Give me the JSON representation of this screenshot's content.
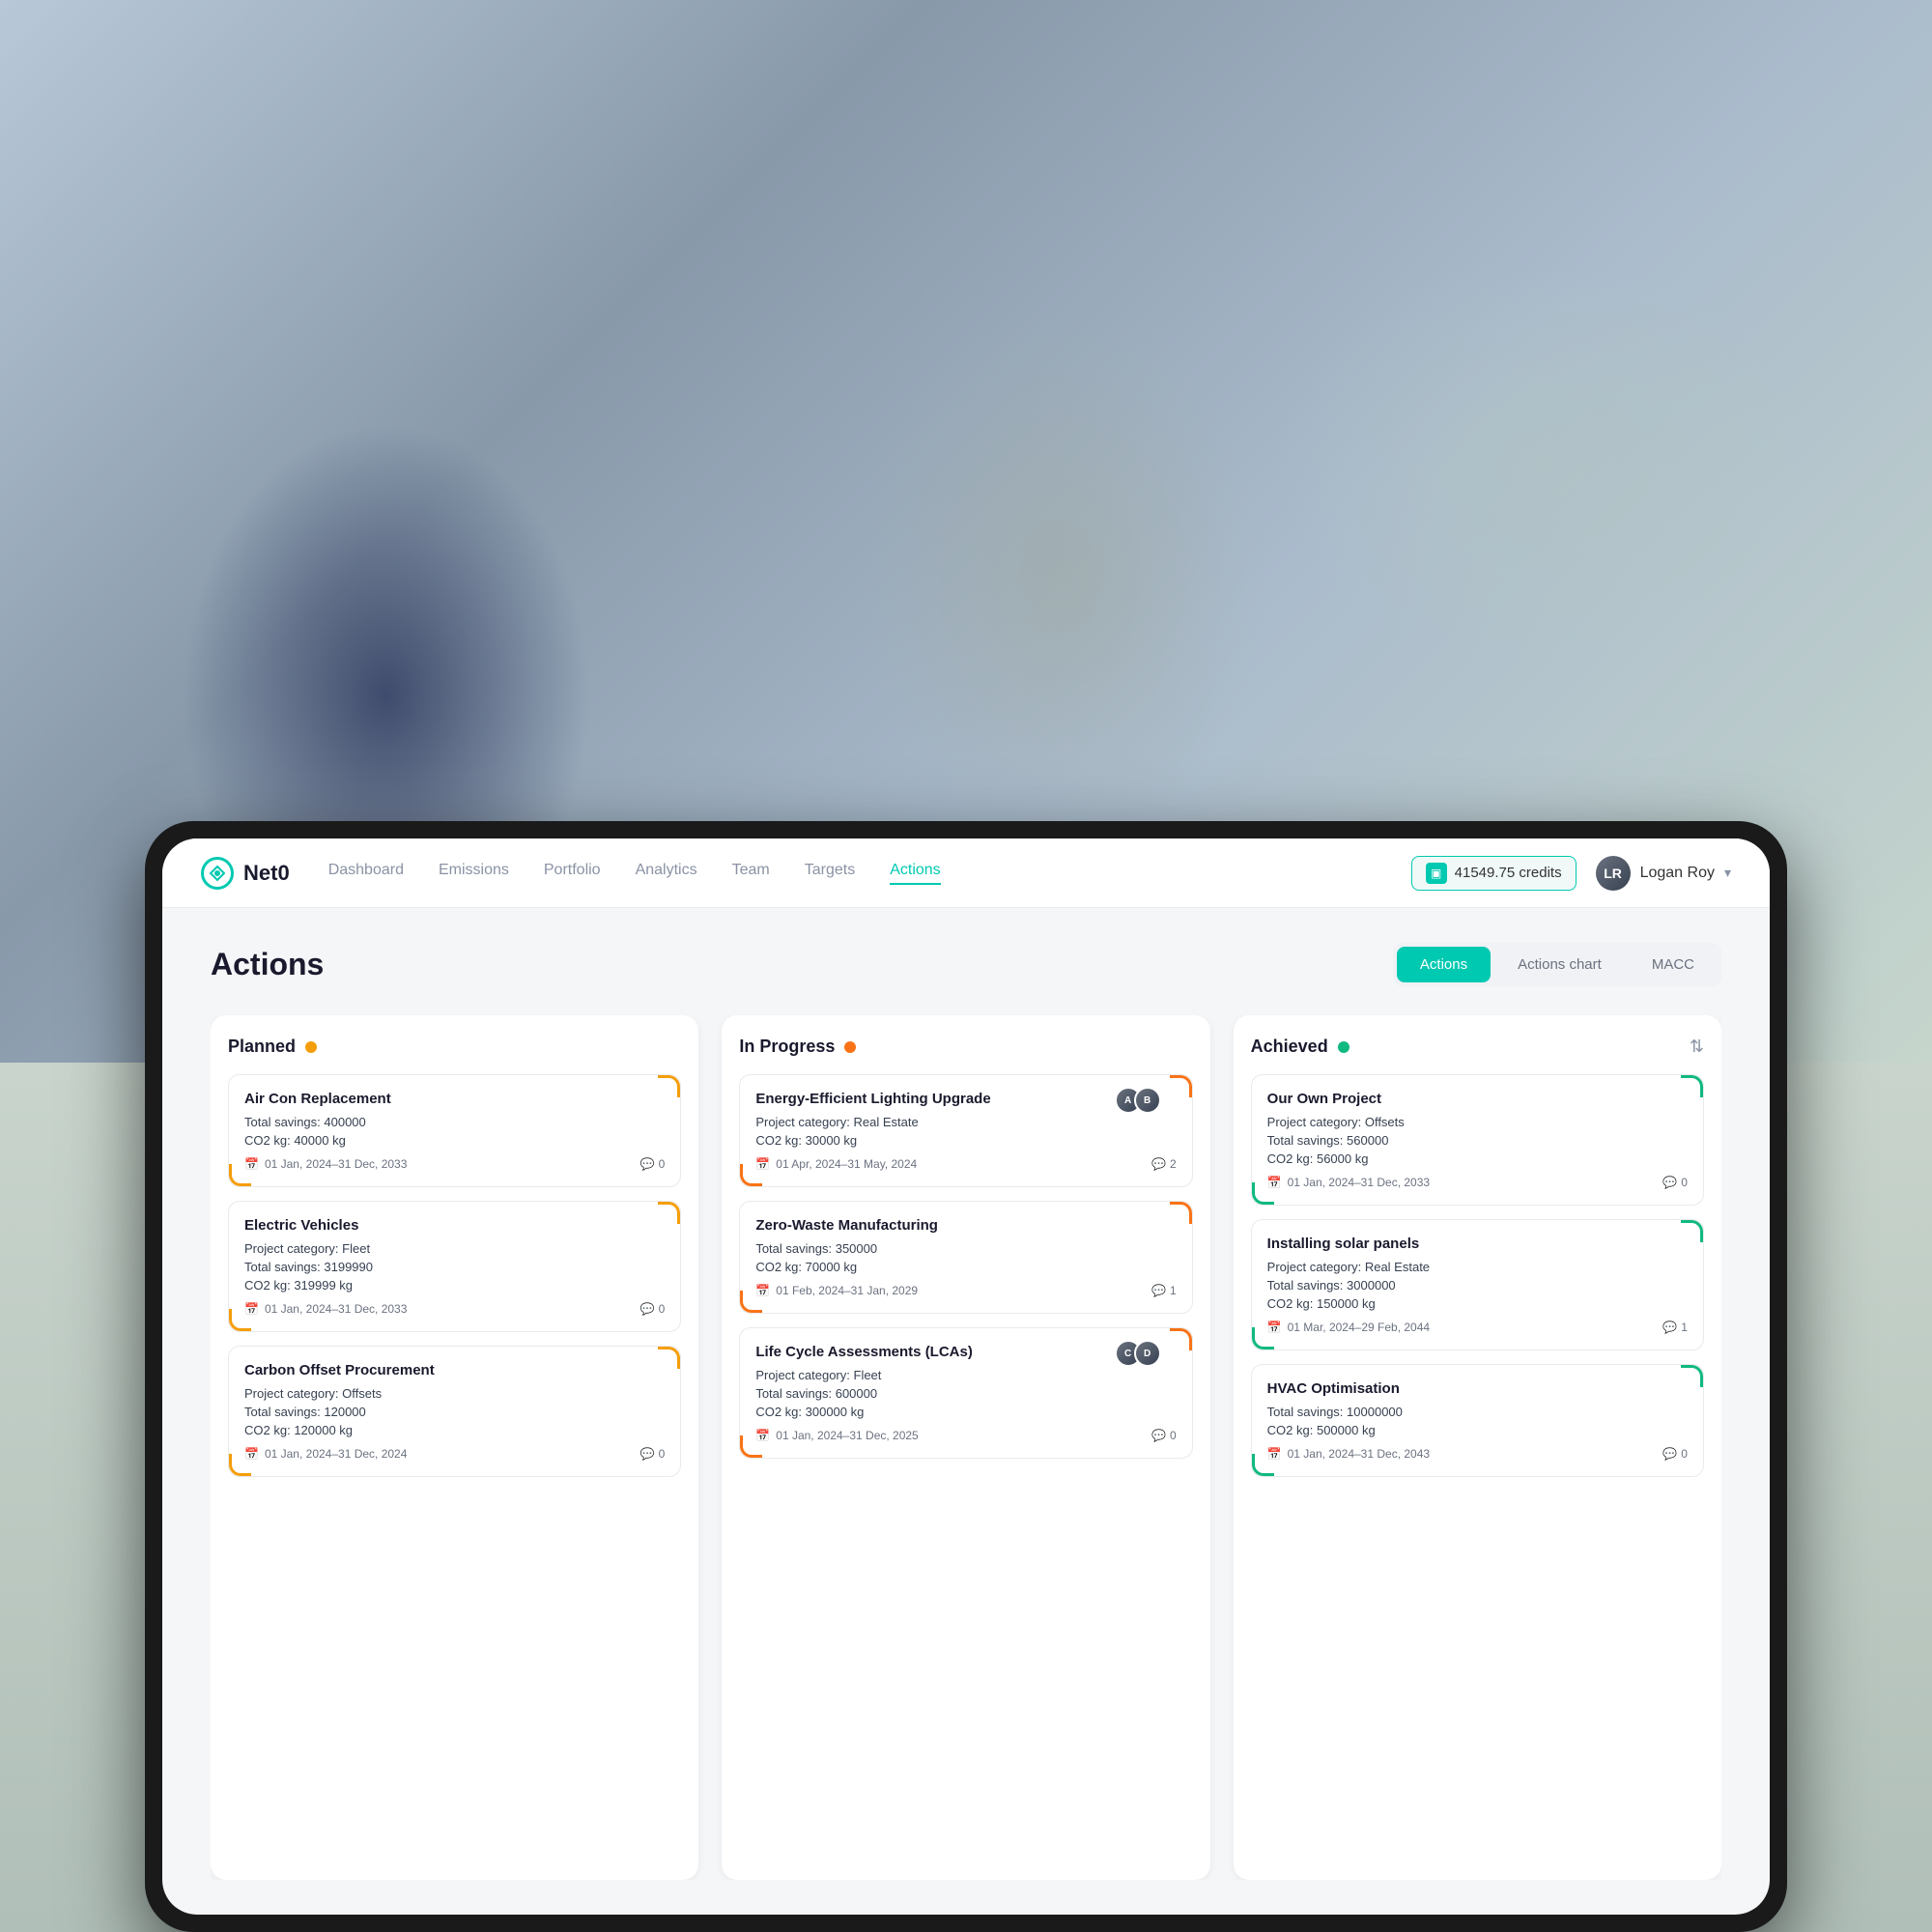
{
  "background": {
    "alt": "Business people walking blurred background"
  },
  "navbar": {
    "logo_text": "Net0",
    "links": [
      {
        "label": "Dashboard",
        "active": false
      },
      {
        "label": "Emissions",
        "active": false
      },
      {
        "label": "Portfolio",
        "active": false
      },
      {
        "label": "Analytics",
        "active": false
      },
      {
        "label": "Team",
        "active": false
      },
      {
        "label": "Targets",
        "active": false
      },
      {
        "label": "Actions",
        "active": true
      }
    ],
    "credits": "41549.75 credits",
    "user_name": "Logan Roy",
    "user_initials": "LR"
  },
  "page": {
    "title": "Actions",
    "view_tabs": [
      {
        "label": "Actions",
        "active": true
      },
      {
        "label": "Actions chart",
        "active": false
      },
      {
        "label": "MACC",
        "active": false
      }
    ]
  },
  "columns": [
    {
      "id": "planned",
      "title": "Planned",
      "status": "yellow",
      "cards": [
        {
          "title": "Air Con Replacement",
          "total_savings_label": "Total savings:",
          "total_savings": "400000",
          "co2_label": "CO2 kg:",
          "co2": "40000 kg",
          "date": "01 Jan, 2024–31 Dec, 2033",
          "comments": "0",
          "has_avatars": false
        },
        {
          "title": "Electric Vehicles",
          "project_category_label": "Project category:",
          "project_category": "Fleet",
          "total_savings_label": "Total savings:",
          "total_savings": "3199990",
          "co2_label": "CO2 kg:",
          "co2": "319999 kg",
          "date": "01 Jan, 2024–31 Dec, 2033",
          "comments": "0",
          "has_avatars": false
        },
        {
          "title": "Carbon Offset Procurement",
          "project_category_label": "Project category:",
          "project_category": "Offsets",
          "total_savings_label": "Total savings:",
          "total_savings": "120000",
          "co2_label": "CO2 kg:",
          "co2": "120000 kg",
          "date": "01 Jan, 2024–31 Dec, 2024",
          "comments": "0",
          "has_avatars": false
        }
      ]
    },
    {
      "id": "inprogress",
      "title": "In Progress",
      "status": "orange",
      "cards": [
        {
          "title": "Energy-Efficient Lighting Upgrade",
          "project_category_label": "Project category:",
          "project_category": "Real Estate",
          "co2_label": "CO2 kg:",
          "co2": "30000 kg",
          "date": "01 Apr, 2024–31 May, 2024",
          "comments": "2",
          "has_avatars": true,
          "avatar_count": 2
        },
        {
          "title": "Zero-Waste Manufacturing",
          "total_savings_label": "Total savings:",
          "total_savings": "350000",
          "co2_label": "CO2 kg:",
          "co2": "70000 kg",
          "date": "01 Feb, 2024–31 Jan, 2029",
          "comments": "1",
          "has_avatars": false
        },
        {
          "title": "Life Cycle Assessments (LCAs)",
          "project_category_label": "Project category:",
          "project_category": "Fleet",
          "total_savings_label": "Total savings:",
          "total_savings": "600000",
          "co2_label": "CO2 kg:",
          "co2": "300000 kg",
          "date": "01 Jan, 2024–31 Dec, 2025",
          "comments": "0",
          "has_avatars": true,
          "avatar_count": 2
        }
      ]
    },
    {
      "id": "achieved",
      "title": "Achieved",
      "status": "green",
      "cards": [
        {
          "title": "Our Own Project",
          "project_category_label": "Project category:",
          "project_category": "Offsets",
          "total_savings_label": "Total savings:",
          "total_savings": "560000",
          "co2_label": "CO2 kg:",
          "co2": "56000 kg",
          "date": "01 Jan, 2024–31 Dec, 2033",
          "comments": "0",
          "has_avatars": false
        },
        {
          "title": "Installing solar panels",
          "project_category_label": "Project category:",
          "project_category": "Real Estate",
          "total_savings_label": "Total savings:",
          "total_savings": "3000000",
          "co2_label": "CO2 kg:",
          "co2": "150000 kg",
          "date": "01 Mar, 2024–29 Feb, 2044",
          "comments": "1",
          "has_avatars": false
        },
        {
          "title": "HVAC Optimisation",
          "total_savings_label": "Total savings:",
          "total_savings": "10000000",
          "co2_label": "CO2 kg:",
          "co2": "500000 kg",
          "date": "01 Jan, 2024–31 Dec, 2043",
          "comments": "0",
          "has_avatars": false
        }
      ]
    }
  ]
}
